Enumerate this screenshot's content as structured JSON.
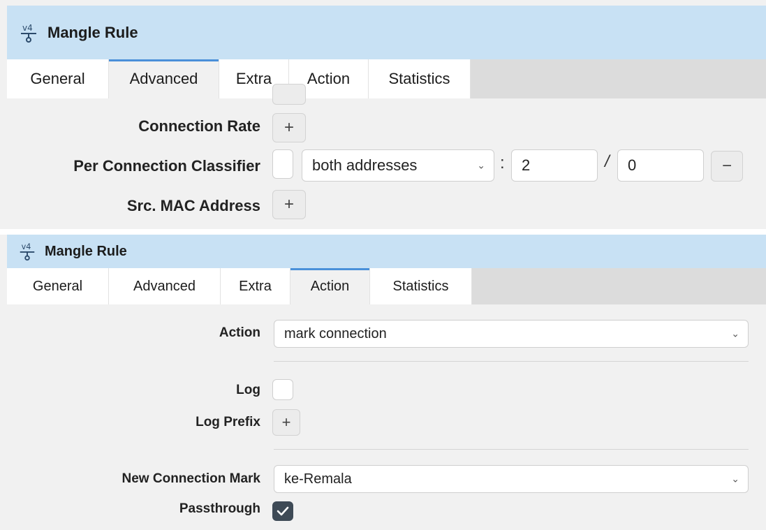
{
  "panels": [
    {
      "title": "Mangle Rule",
      "icon": "ipv4-mangle-icon",
      "tabs": [
        "General",
        "Advanced",
        "Extra",
        "Action",
        "Statistics"
      ],
      "active_tab": "Advanced",
      "fields": {
        "connection_rate": {
          "label": "Connection Rate",
          "button": "+"
        },
        "pcc": {
          "label": "Per Connection Classifier",
          "checked": false,
          "mode": "both addresses",
          "separator_colon": ":",
          "every": "2",
          "separator_slash": "/",
          "remainder": "0",
          "remove_button": "−"
        },
        "src_mac": {
          "label": "Src. MAC Address",
          "button": "+"
        }
      }
    },
    {
      "title": "Mangle Rule",
      "icon": "ipv4-mangle-icon",
      "tabs": [
        "General",
        "Advanced",
        "Extra",
        "Action",
        "Statistics"
      ],
      "active_tab": "Action",
      "fields": {
        "action": {
          "label": "Action",
          "value": "mark connection"
        },
        "log": {
          "label": "Log",
          "checked": false
        },
        "log_prefix": {
          "label": "Log Prefix",
          "button": "+"
        },
        "new_connection_mark": {
          "label": "New Connection Mark",
          "value": "ke-Remala"
        },
        "passthrough": {
          "label": "Passthrough",
          "checked": true
        }
      }
    }
  ],
  "colors": {
    "titlebar": "#c8e1f4",
    "active_tab_indicator": "#4a90d9",
    "panel_bg": "#f1f1f1",
    "checkbox_checked": "#3e4a56"
  }
}
